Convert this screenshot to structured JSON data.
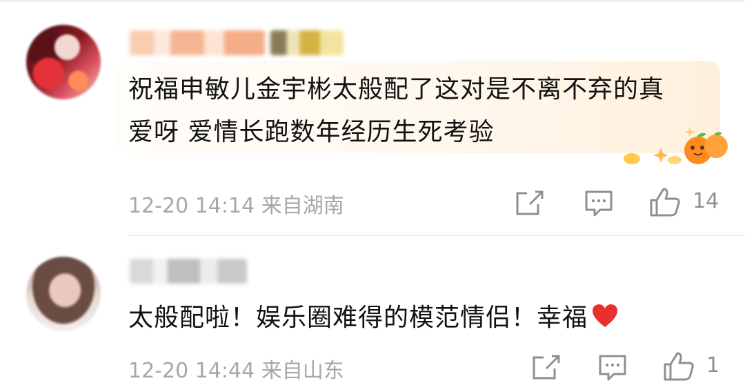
{
  "comments": [
    {
      "text": "祝福申敏儿金宇彬太般配了这对是不离不弃的真",
      "text_line2": "爱呀 爱情长跑数年经历生死考验",
      "date": "12-20 14:14",
      "location": "来自湖南",
      "like_count": "14",
      "share_icon": "share-icon",
      "reply_icon": "comment-icon",
      "like_icon": "thumbs-up-icon"
    },
    {
      "text": "太般配啦！娱乐圈难得的模范情侣！幸福",
      "emoji_icon": "red-heart-icon",
      "date": "12-20 14:44",
      "location": "来自山东",
      "like_count": "1",
      "share_icon": "share-icon",
      "reply_icon": "comment-icon",
      "like_icon": "thumbs-up-icon"
    }
  ],
  "colors": {
    "meta_text": "#a7a7a7",
    "icon": "#8f8f8f",
    "heart": "#e8302f",
    "bubble": "#fff4e6"
  }
}
